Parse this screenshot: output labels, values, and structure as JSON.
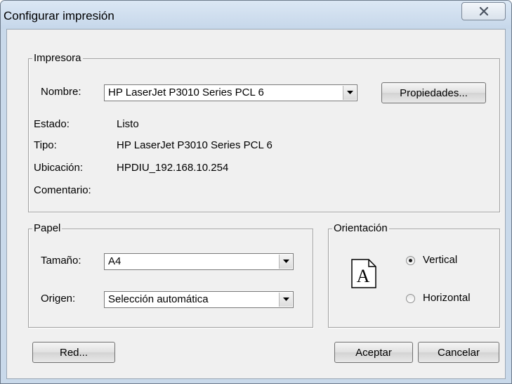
{
  "window": {
    "title": "Configurar impresión"
  },
  "icons": {
    "close": "close-x-icon",
    "dropdown": "chevron-down-icon",
    "orientation": "page-portrait-icon"
  },
  "printer": {
    "legend": "Impresora",
    "name_label": "Nombre:",
    "name_value": "HP LaserJet P3010 Series PCL 6",
    "properties_button": "Propiedades...",
    "status_label": "Estado:",
    "status_value": "Listo",
    "type_label": "Tipo:",
    "type_value": "HP LaserJet P3010 Series PCL 6",
    "location_label": "Ubicación:",
    "location_value": "HPDIU_192.168.10.254",
    "comment_label": "Comentario:",
    "comment_value": ""
  },
  "paper": {
    "legend": "Papel",
    "size_label": "Tamaño:",
    "size_value": "A4",
    "source_label": "Origen:",
    "source_value": "Selección automática"
  },
  "orientation": {
    "legend": "Orientación",
    "icon_letter": "A",
    "options": [
      {
        "label": "Vertical",
        "selected": true
      },
      {
        "label": "Horizontal",
        "selected": false
      }
    ]
  },
  "buttons": {
    "network": "Red...",
    "ok": "Aceptar",
    "cancel": "Cancelar"
  }
}
